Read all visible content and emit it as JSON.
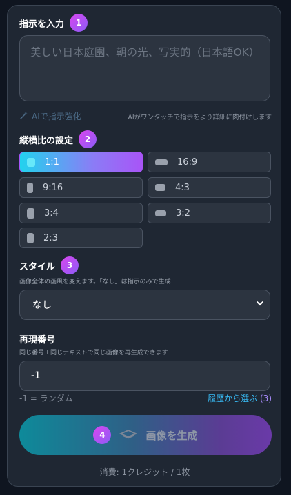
{
  "prompt": {
    "title": "指示を入力",
    "step": "1",
    "placeholder": "美しい日本庭園、朝の光、写実的（日本語OK）",
    "enhance_label": "AIで指示強化",
    "enhance_hint": "AIがワンタッチで指示をより詳細に肉付けします"
  },
  "aspect": {
    "title": "縦横比の設定",
    "step": "2",
    "selected": "1:1",
    "options": [
      {
        "label": "1:1",
        "shape": "square"
      },
      {
        "label": "16:9",
        "shape": "wide"
      },
      {
        "label": "9:16",
        "shape": "tall"
      },
      {
        "label": "4:3",
        "shape": "wide"
      },
      {
        "label": "3:4",
        "shape": "tall"
      },
      {
        "label": "3:2",
        "shape": "wide"
      },
      {
        "label": "2:3",
        "shape": "tall"
      }
    ]
  },
  "style": {
    "title": "スタイル",
    "step": "3",
    "description": "画像全体の画風を変えます。「なし」は指示のみで生成",
    "selected": "なし"
  },
  "seed": {
    "title": "再現番号",
    "description": "同じ番号＋同じテキストで同じ画像を再生成できます",
    "value": "-1",
    "random_hint": "-1 = ランダム",
    "history_label": "履歴から選ぶ",
    "history_count": "(3)"
  },
  "generate": {
    "step": "4",
    "label": "画像を生成",
    "credits": "消費: 1クレジット / 1枚"
  },
  "colors": {
    "accent_start": "#22d3ee",
    "accent_end": "#a855f7",
    "badge": "#c84bf0"
  }
}
